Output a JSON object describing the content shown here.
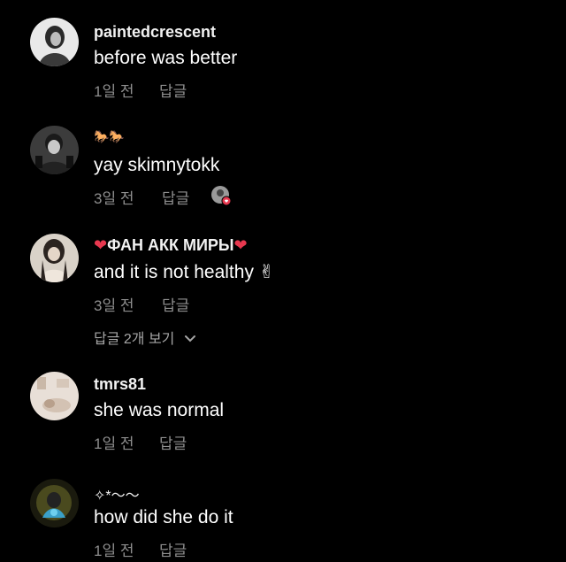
{
  "comments": [
    {
      "username": "paintedcrescent",
      "text": "before was better",
      "time": "1일 전",
      "reply_label": "답글"
    },
    {
      "username": "🐎🐎",
      "text": "yay skimnytokk",
      "time": "3일 전",
      "reply_label": "답글"
    },
    {
      "username_prefix": "❤",
      "username": "ФАН АКК МИРЫ",
      "username_suffix": "❤",
      "text": "and it is not healthy ✌",
      "time": "3일 전",
      "reply_label": "답글"
    },
    {
      "username": "tmrs81",
      "text": "she was normal",
      "time": "1일 전",
      "reply_label": "답글"
    },
    {
      "username": "✧*～～",
      "text": "how did she do it",
      "time": "1일 전",
      "reply_label": "답글"
    }
  ],
  "view_replies": {
    "label": "답글 2개 보기",
    "icon": "chevron-down-icon"
  },
  "colors": {
    "background": "#000000",
    "text": "#ffffff",
    "meta": "#8e8e8e",
    "heart": "#e8384f"
  }
}
